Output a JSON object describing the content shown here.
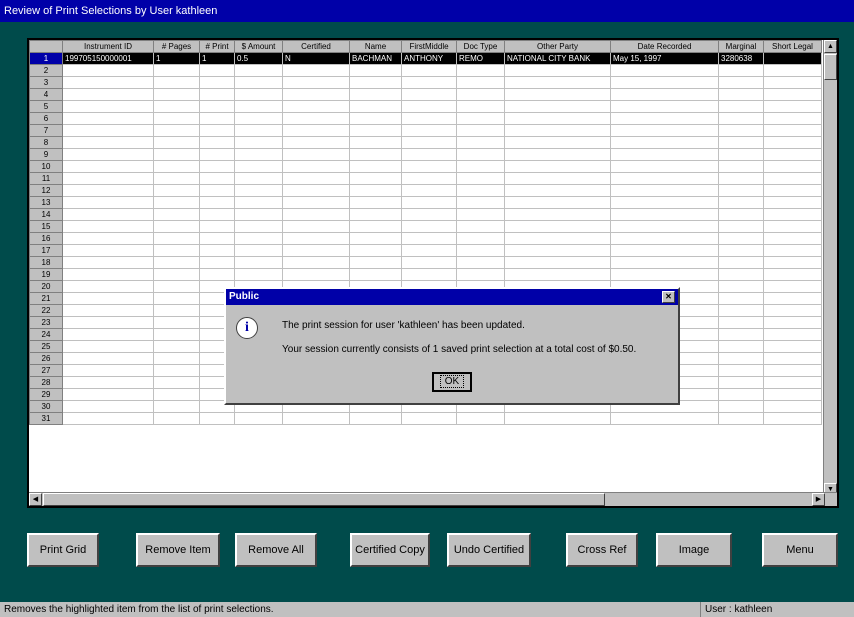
{
  "window": {
    "title": "Review of Print Selections by User kathleen"
  },
  "grid": {
    "columns": [
      "",
      "Instrument ID",
      "# Pages",
      "# Print",
      "$ Amount",
      "Certified",
      "Name",
      "FirstMiddle",
      "Doc Type",
      "Other Party",
      "Date Recorded",
      "Marginal",
      "Short Legal"
    ],
    "rows": [
      [
        "1",
        "199705150000001",
        "1",
        "1",
        "0.5",
        "N",
        "BACHMAN",
        "ANTHONY",
        "REMO",
        "NATIONAL CITY BANK",
        "May 15, 1997",
        "3280638",
        ""
      ]
    ],
    "row_numbers": [
      "2",
      "3",
      "4",
      "5",
      "6",
      "7",
      "8",
      "9",
      "10",
      "11",
      "12",
      "13",
      "14",
      "15",
      "16",
      "17",
      "18",
      "19",
      "20",
      "21",
      "22",
      "23",
      "24",
      "25",
      "26",
      "27",
      "28",
      "29",
      "30",
      "31"
    ]
  },
  "buttons": {
    "print_grid": "Print Grid",
    "remove_item": "Remove Item",
    "remove_all": "Remove All",
    "certified_copy": "Certified Copy",
    "undo_certified": "Undo Certified",
    "cross_ref": "Cross Ref",
    "image": "Image",
    "menu": "Menu"
  },
  "dialog": {
    "title": "Public",
    "close_glyph": "✕",
    "icon_glyph": "i",
    "line1": "The print session for user 'kathleen' has been updated.",
    "line2": "Your session currently consists of 1 saved print selection at a total cost of $0.50.",
    "ok": "OK"
  },
  "status": {
    "message": "Removes the highlighted item from the list of print selections.",
    "user": "User : kathleen"
  }
}
